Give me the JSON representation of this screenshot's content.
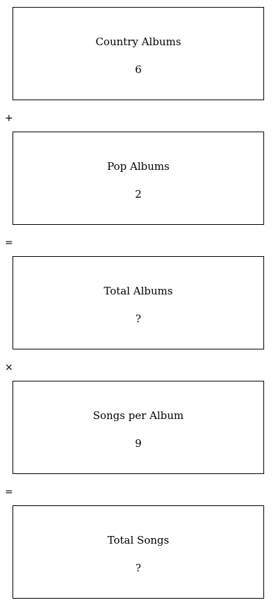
{
  "boxes": [
    {
      "label": "Country Albums",
      "value": "6"
    },
    {
      "label": "Pop Albums",
      "value": "2"
    },
    {
      "label": "Total Albums",
      "value": "?"
    },
    {
      "label": "Songs per Album",
      "value": "9"
    },
    {
      "label": "Total Songs",
      "value": "?"
    }
  ],
  "operators": [
    "+",
    "=",
    "×",
    "="
  ]
}
